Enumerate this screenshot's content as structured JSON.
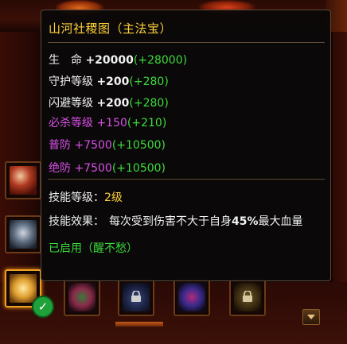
{
  "tooltip": {
    "title": "山河社稷图（主法宝）",
    "stats": [
      {
        "label": "生　命",
        "value": "+20000",
        "bonus": "(+28000)",
        "color": "white"
      },
      {
        "label": "守护等级",
        "value": "+200",
        "bonus": "(+280)",
        "color": "white"
      },
      {
        "label": "闪避等级",
        "value": "+200",
        "bonus": "(+280)",
        "color": "white"
      },
      {
        "label": "必杀等级",
        "value": "+150",
        "bonus": "(+210)",
        "color": "purple"
      },
      {
        "label": "普防",
        "value": "+7500",
        "bonus": "(+10500)",
        "color": "purple"
      },
      {
        "label": "绝防",
        "value": "+7500",
        "bonus": "(+10500)",
        "color": "purple"
      }
    ],
    "skill_level_label": "技能等级：",
    "skill_level_value": "2级",
    "skill_effect_label": "技能效果：",
    "skill_effect_pre": "每次受到伤害不大于自身",
    "skill_effect_pct": "45%",
    "skill_effect_post": "最大血量",
    "status": "已启用（醒不愁）"
  },
  "colors": {
    "title": "#ffd23a",
    "bonus_green": "#3cdc3c",
    "purple_quality": "#d850e8",
    "tooltip_border": "#5a4a3a"
  },
  "icons": {
    "slots": [
      "umbrella-treasure-icon",
      "armor-treasure-icon",
      "scroll-treasure-icon",
      "dragon-treasure-icon",
      "locked-slot-icon",
      "wing-treasure-icon",
      "locked-slot-icon"
    ],
    "equipped": "checkmark-icon",
    "scroll": "arrow-down-icon"
  }
}
